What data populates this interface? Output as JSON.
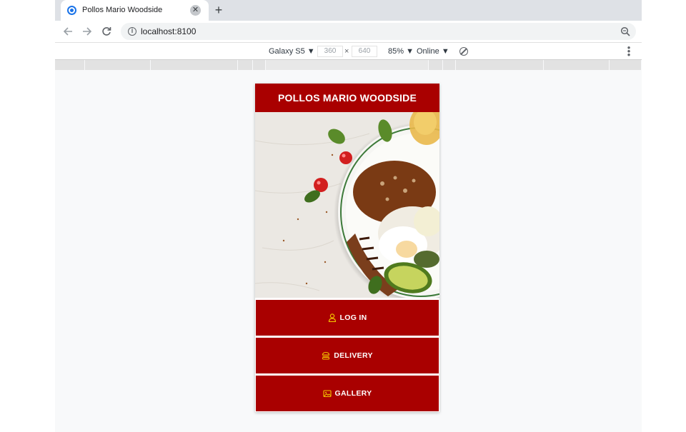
{
  "browser": {
    "tab_title": "Pollos Mario Woodside",
    "url": "localhost:8100"
  },
  "devtools": {
    "device": "Galaxy S5 ▼",
    "width": "360",
    "height": "640",
    "zoom": "85% ▼",
    "network": "Online ▼"
  },
  "app": {
    "title": "POLLOS MARIO WOODSIDE",
    "menu": [
      {
        "label": "LOG IN",
        "icon": "person-icon"
      },
      {
        "label": "DELIVERY",
        "icon": "burger-icon"
      },
      {
        "label": "GALLERY",
        "icon": "image-icon"
      }
    ]
  },
  "colors": {
    "brand_red": "#a90000",
    "icon_gold": "#f2c200"
  }
}
